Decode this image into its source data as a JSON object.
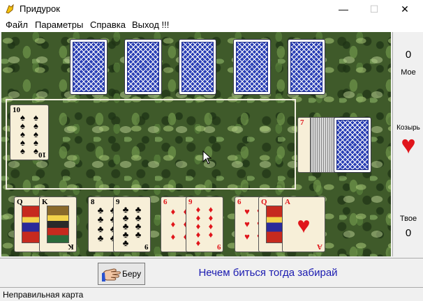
{
  "window": {
    "title": "Придурок",
    "minimize": "—",
    "maximize": "☐",
    "close": "✕"
  },
  "menu": [
    "Файл",
    "Параметры",
    "Справка",
    "Выход !!!"
  ],
  "scores": {
    "mine_value": "0",
    "mine_label": "Мое",
    "yours_label": "Твое",
    "yours_value": "0"
  },
  "trump": {
    "label": "Козырь",
    "suit": "hearts",
    "symbol": "♥",
    "color": "#e0151b"
  },
  "opponent_hand": {
    "cards_face_down": 5
  },
  "table_cards": [
    {
      "rank": "10",
      "suit": "♠"
    }
  ],
  "deck": {
    "trump_card_rank": "7",
    "trump_card_suit": "♥"
  },
  "player_hand": [
    {
      "rank": "Q",
      "suit": "♠"
    },
    {
      "rank": "K",
      "suit": "♠"
    },
    {
      "rank": "8",
      "suit": "♣"
    },
    {
      "rank": "9",
      "suit": "♣"
    },
    {
      "rank": "6",
      "suit": "♦"
    },
    {
      "rank": "9",
      "suit": "♦"
    },
    {
      "rank": "6",
      "suit": "♥"
    },
    {
      "rank": "Q",
      "suit": "♥"
    },
    {
      "rank": "A",
      "suit": "♥"
    }
  ],
  "take_button": {
    "label": "Беру"
  },
  "hint": "Нечем биться тогда забирай",
  "status": "Неправильная карта"
}
